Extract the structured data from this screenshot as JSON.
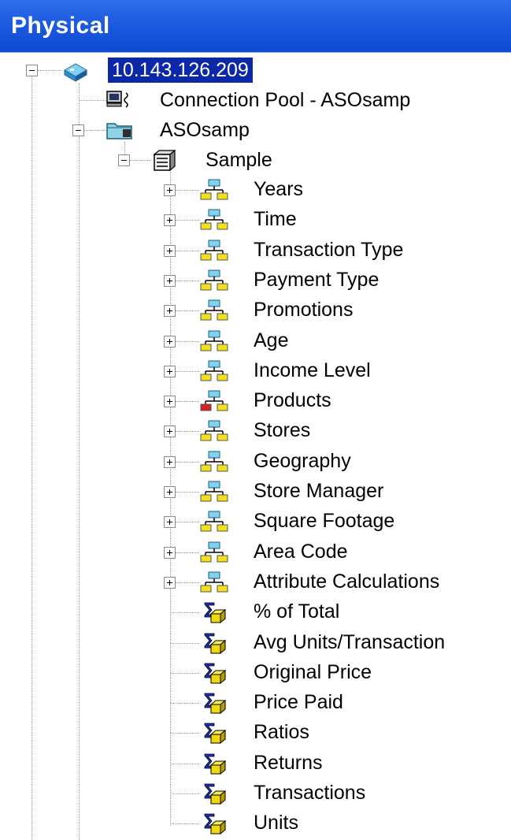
{
  "panel": {
    "title": "Physical"
  },
  "tree": {
    "server": {
      "label": "10.143.126.209",
      "selected": true
    },
    "connection_pool": {
      "label": "Connection Pool - ASOsamp"
    },
    "database": {
      "label": "ASOsamp"
    },
    "schema": {
      "label": "Sample"
    },
    "dimensions": [
      "Years",
      "Time",
      "Transaction Type",
      "Payment Type",
      "Promotions",
      "Age",
      "Income Level",
      "Products",
      "Stores",
      "Geography",
      "Store Manager",
      "Square Footage",
      "Area Code",
      "Attribute Calculations"
    ],
    "measures": [
      "% of Total",
      "Avg Units/Transaction",
      "Original Price",
      "Price Paid",
      "Ratios",
      "Returns",
      "Transactions",
      "Units"
    ]
  },
  "icons": {
    "server": "server-cube-icon",
    "connection_pool": "connection-pool-icon",
    "database": "database-folder-icon",
    "schema": "schema-table-icon",
    "dimension": "hierarchy-icon",
    "dimension_products": "hierarchy-icon-red",
    "measure": "measure-cube-icon"
  },
  "colors": {
    "title_bar": "#1c5ae0",
    "selection": "#0b28a8"
  }
}
